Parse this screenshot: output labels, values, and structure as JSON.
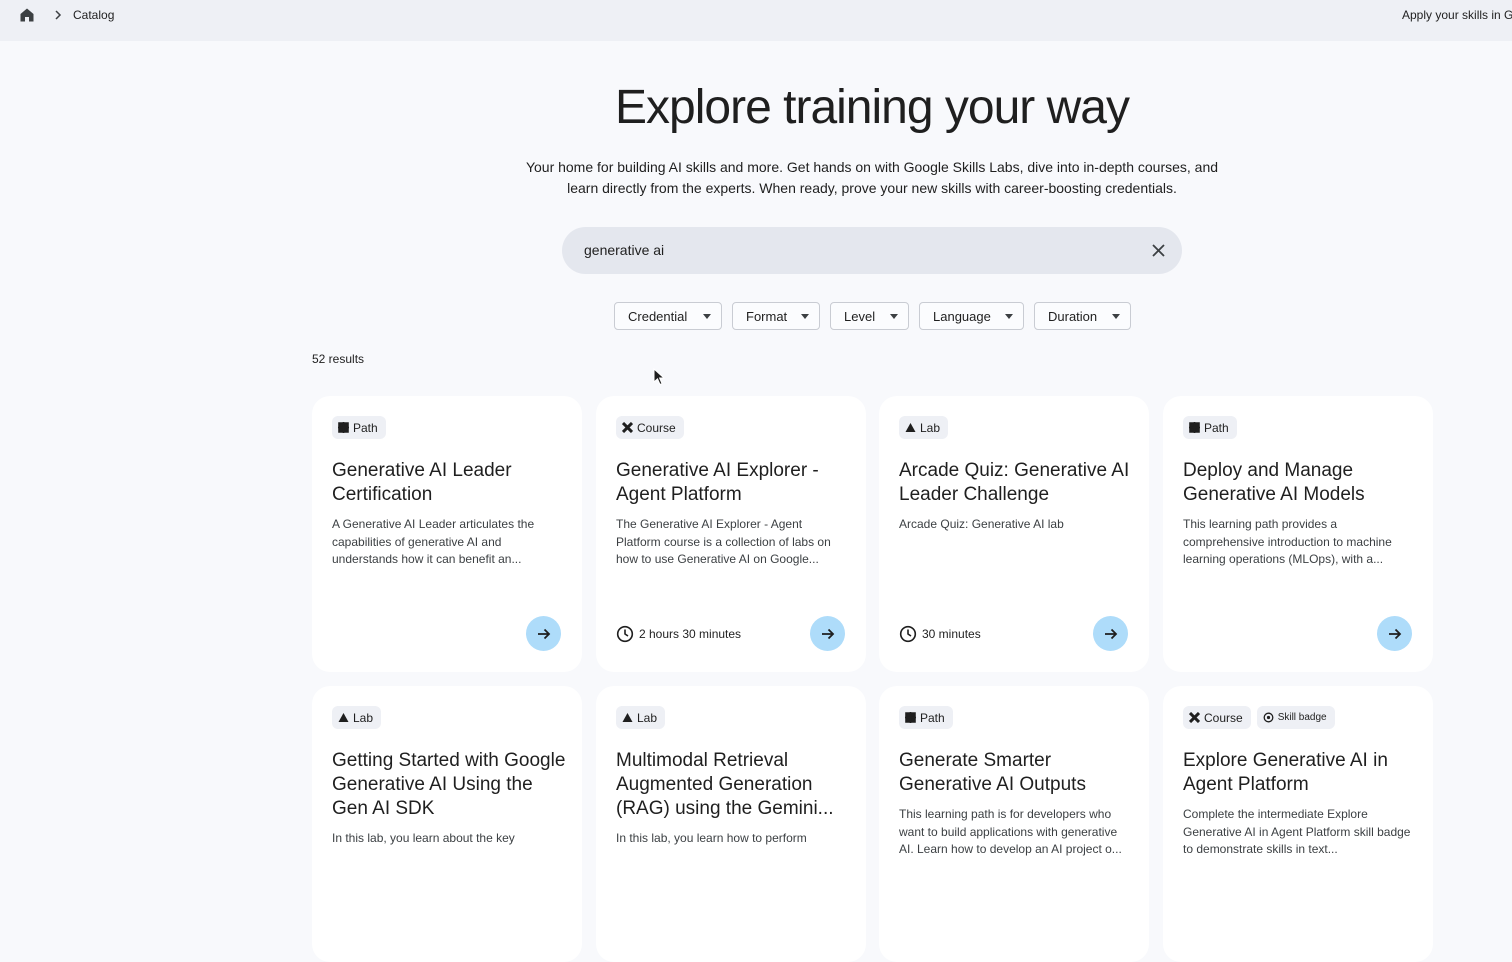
{
  "topbar": {
    "breadcrumb": "Catalog",
    "promo_text": "Apply your skills in G"
  },
  "hero": {
    "title": "Explore training your way",
    "subtitle": "Your home for building AI skills and more. Get hands on with Google Skills Labs, dive into in-depth courses, and learn directly from the experts. When ready, prove your new skills with career-boosting credentials."
  },
  "search": {
    "value": "generative ai"
  },
  "filters": [
    "Credential",
    "Format",
    "Level",
    "Language",
    "Duration"
  ],
  "results_label": "52 results",
  "cards": [
    {
      "badges": [
        {
          "icon": "path-icon",
          "label": "Path"
        }
      ],
      "title": "Generative AI Leader Certification",
      "description": "A Generative AI Leader articulates the capabilities of generative AI and understands how it can benefit an...",
      "duration": ""
    },
    {
      "badges": [
        {
          "icon": "course-icon",
          "label": "Course"
        }
      ],
      "title": "Generative AI Explorer - Agent Platform",
      "description": "The Generative AI Explorer - Agent Platform course is a collection of labs on how to use Generative AI on Google...",
      "duration": "2 hours 30 minutes"
    },
    {
      "badges": [
        {
          "icon": "lab-icon",
          "label": "Lab"
        }
      ],
      "title": "Arcade Quiz: Generative AI Leader Challenge",
      "description": "Arcade Quiz: Generative AI lab",
      "duration": "30 minutes"
    },
    {
      "badges": [
        {
          "icon": "path-icon",
          "label": "Path"
        }
      ],
      "title": "Deploy and Manage Generative AI Models",
      "description": "This learning path provides a comprehensive introduction to machine learning operations (MLOps), with a...",
      "duration": ""
    },
    {
      "badges": [
        {
          "icon": "lab-icon",
          "label": "Lab"
        }
      ],
      "title": "Getting Started with Google Generative AI Using the Gen AI SDK",
      "description": "In this lab, you learn about the key",
      "duration": ""
    },
    {
      "badges": [
        {
          "icon": "lab-icon",
          "label": "Lab"
        }
      ],
      "title": "Multimodal Retrieval Augmented Generation (RAG) using the Gemini...",
      "description": "In this lab, you learn how to perform",
      "duration": ""
    },
    {
      "badges": [
        {
          "icon": "path-icon",
          "label": "Path"
        }
      ],
      "title": "Generate Smarter Generative AI Outputs",
      "description": "This learning path is for developers who want to build applications with generative AI. Learn how to develop an AI project o...",
      "duration": ""
    },
    {
      "badges": [
        {
          "icon": "course-icon",
          "label": "Course"
        },
        {
          "icon": "skill-badge-icon",
          "label": "Skill badge"
        }
      ],
      "title": "Explore Generative AI in Agent Platform",
      "description": "Complete the intermediate Explore Generative AI in Agent Platform skill badge to demonstrate skills in text...",
      "duration": ""
    }
  ]
}
